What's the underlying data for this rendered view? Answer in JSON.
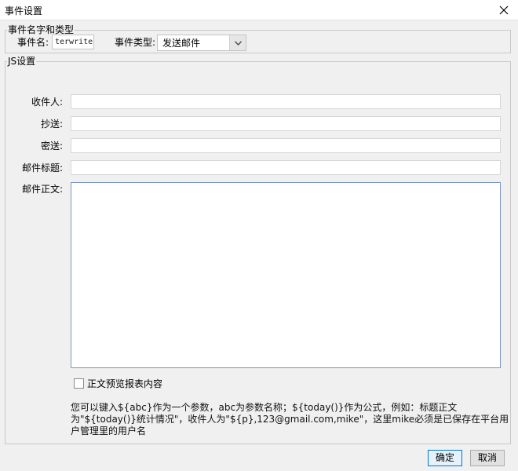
{
  "window": {
    "title": "事件设置"
  },
  "event_group": {
    "legend": "事件名字和类型",
    "name_label": "事件名:",
    "name_value": "terwrite",
    "type_label": "事件类型:",
    "type_value": "发送邮件"
  },
  "js_group": {
    "legend": "JS设置",
    "fields": [
      {
        "label": "收件人:",
        "value": ""
      },
      {
        "label": "抄送:",
        "value": ""
      },
      {
        "label": "密送:",
        "value": ""
      },
      {
        "label": "邮件标题:",
        "value": ""
      }
    ],
    "body_label": "邮件正文:",
    "body_value": "",
    "preview_checkbox_label": "正文预览报表内容",
    "hint_text": "您可以键入${abc}作为一个参数，abc为参数名称；${today()}作为公式，例如：标题正文为\"${today()}统计情况\"，收件人为\"${p},123@gmail.com,mike\"，这里mike必须是已保存在平台用户管理里的用户名"
  },
  "buttons": {
    "ok": "确定",
    "cancel": "取消"
  }
}
